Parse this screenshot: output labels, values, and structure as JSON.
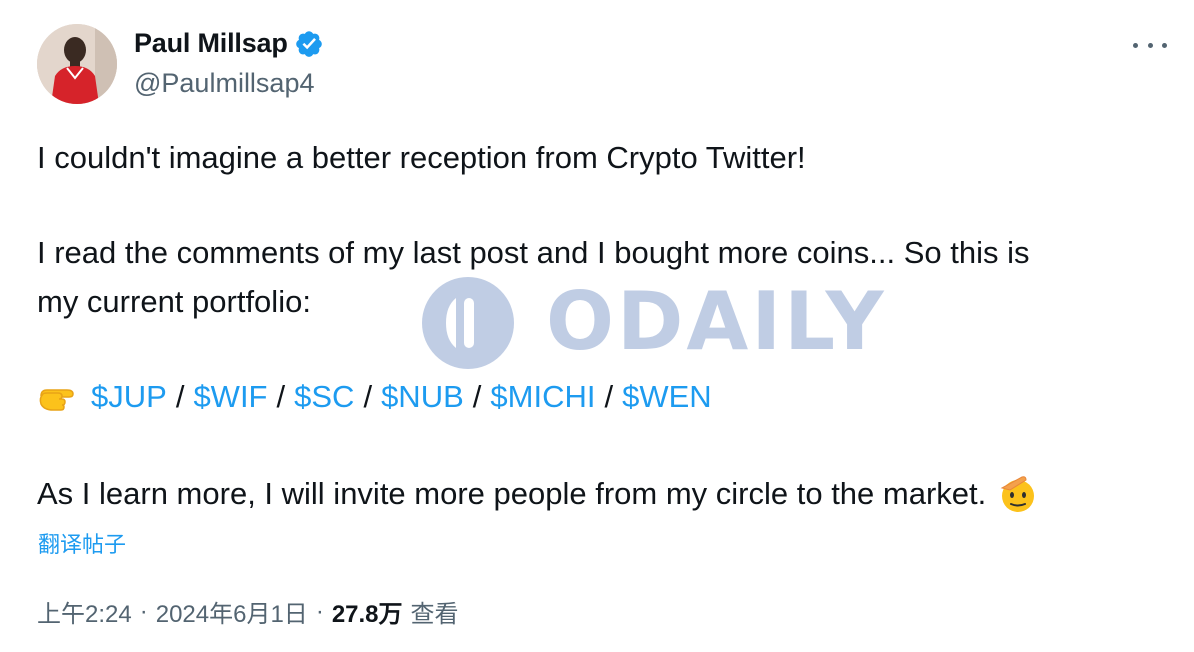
{
  "author": {
    "display_name": "Paul Millsap",
    "handle": "@Paulmillsap4",
    "verified": true,
    "verified_color": "#1d9bf0"
  },
  "tweet": {
    "line1": "I couldn't imagine a better reception from Crypto Twitter!",
    "line2": "I read the comments of my last post and I bought more coins... So this is",
    "line3": "my current portfolio:",
    "cashtags": [
      "$JUP",
      "$WIF",
      "$SC",
      "$NUB",
      "$MICHI",
      "$WEN"
    ],
    "separator": "/",
    "line5": "As I learn more, I will invite more people from my circle to the market.",
    "emoji_pointer": "backhand-index-pointing-right",
    "emoji_salute": "saluting-face"
  },
  "translate_label": "翻译帖子",
  "meta": {
    "time": "上午2:24",
    "dot": "·",
    "date": "2024年6月1日",
    "views_count": "27.8万",
    "views_label": "查看"
  },
  "watermark": {
    "text": "ODAILY",
    "color": "#8ea5cf"
  },
  "colors": {
    "link": "#1d9bf0",
    "secondary_text": "#536471",
    "primary_text": "#0f1419"
  }
}
